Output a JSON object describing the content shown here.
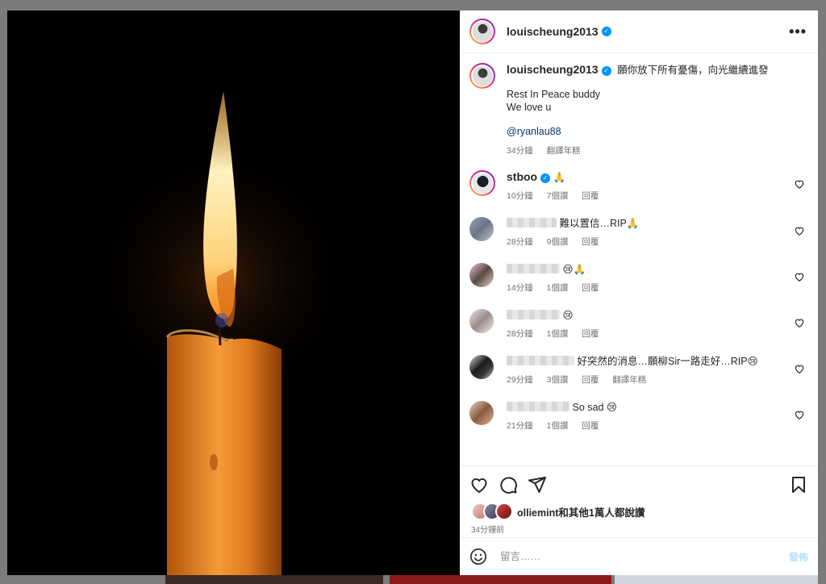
{
  "post": {
    "username": "louischeung2013",
    "verified_icon": "verified-badge-icon",
    "more_icon": "more-options-icon",
    "more_label": "•••"
  },
  "caption": {
    "username": "louischeung2013",
    "line1": "願你放下所有憂傷，向光繼續進發",
    "line2": "Rest In Peace buddy",
    "line3": "We love u",
    "mention": "@ryanlau88",
    "time": "34分鐘",
    "translate": "翻譯年糕"
  },
  "comments": [
    {
      "username": "stboo",
      "text": "🙏",
      "time": "10分鐘",
      "likes": "7個讚",
      "reply": "回覆",
      "extra": ""
    },
    {
      "username": "",
      "text": "難以置信…RIP🙏",
      "time": "28分鐘",
      "likes": "9個讚",
      "reply": "回覆",
      "extra": ""
    },
    {
      "username": "",
      "text": "😢🙏",
      "time": "14分鐘",
      "likes": "1個讚",
      "reply": "回覆",
      "extra": ""
    },
    {
      "username": "",
      "text": "😢",
      "time": "28分鐘",
      "likes": "1個讚",
      "reply": "回覆",
      "extra": ""
    },
    {
      "username": "",
      "text": "好突然的消息…願柳Sir一路走好…RIP😢",
      "time": "29分鐘",
      "likes": "3個讚",
      "reply": "回覆",
      "extra": "翻譯年糕"
    },
    {
      "username": "",
      "text": "So sad 😢",
      "time": "21分鐘",
      "likes": "1個讚",
      "reply": "回覆",
      "extra": ""
    }
  ],
  "likes": {
    "text": "olliemint和其他1萬人都說讚",
    "time_ago": "34分鐘前"
  },
  "comment_box": {
    "placeholder": "留言……",
    "post_label": "發佈"
  },
  "colors": {
    "accent": "#0095f6",
    "link": "#00376b",
    "muted": "#737373"
  }
}
